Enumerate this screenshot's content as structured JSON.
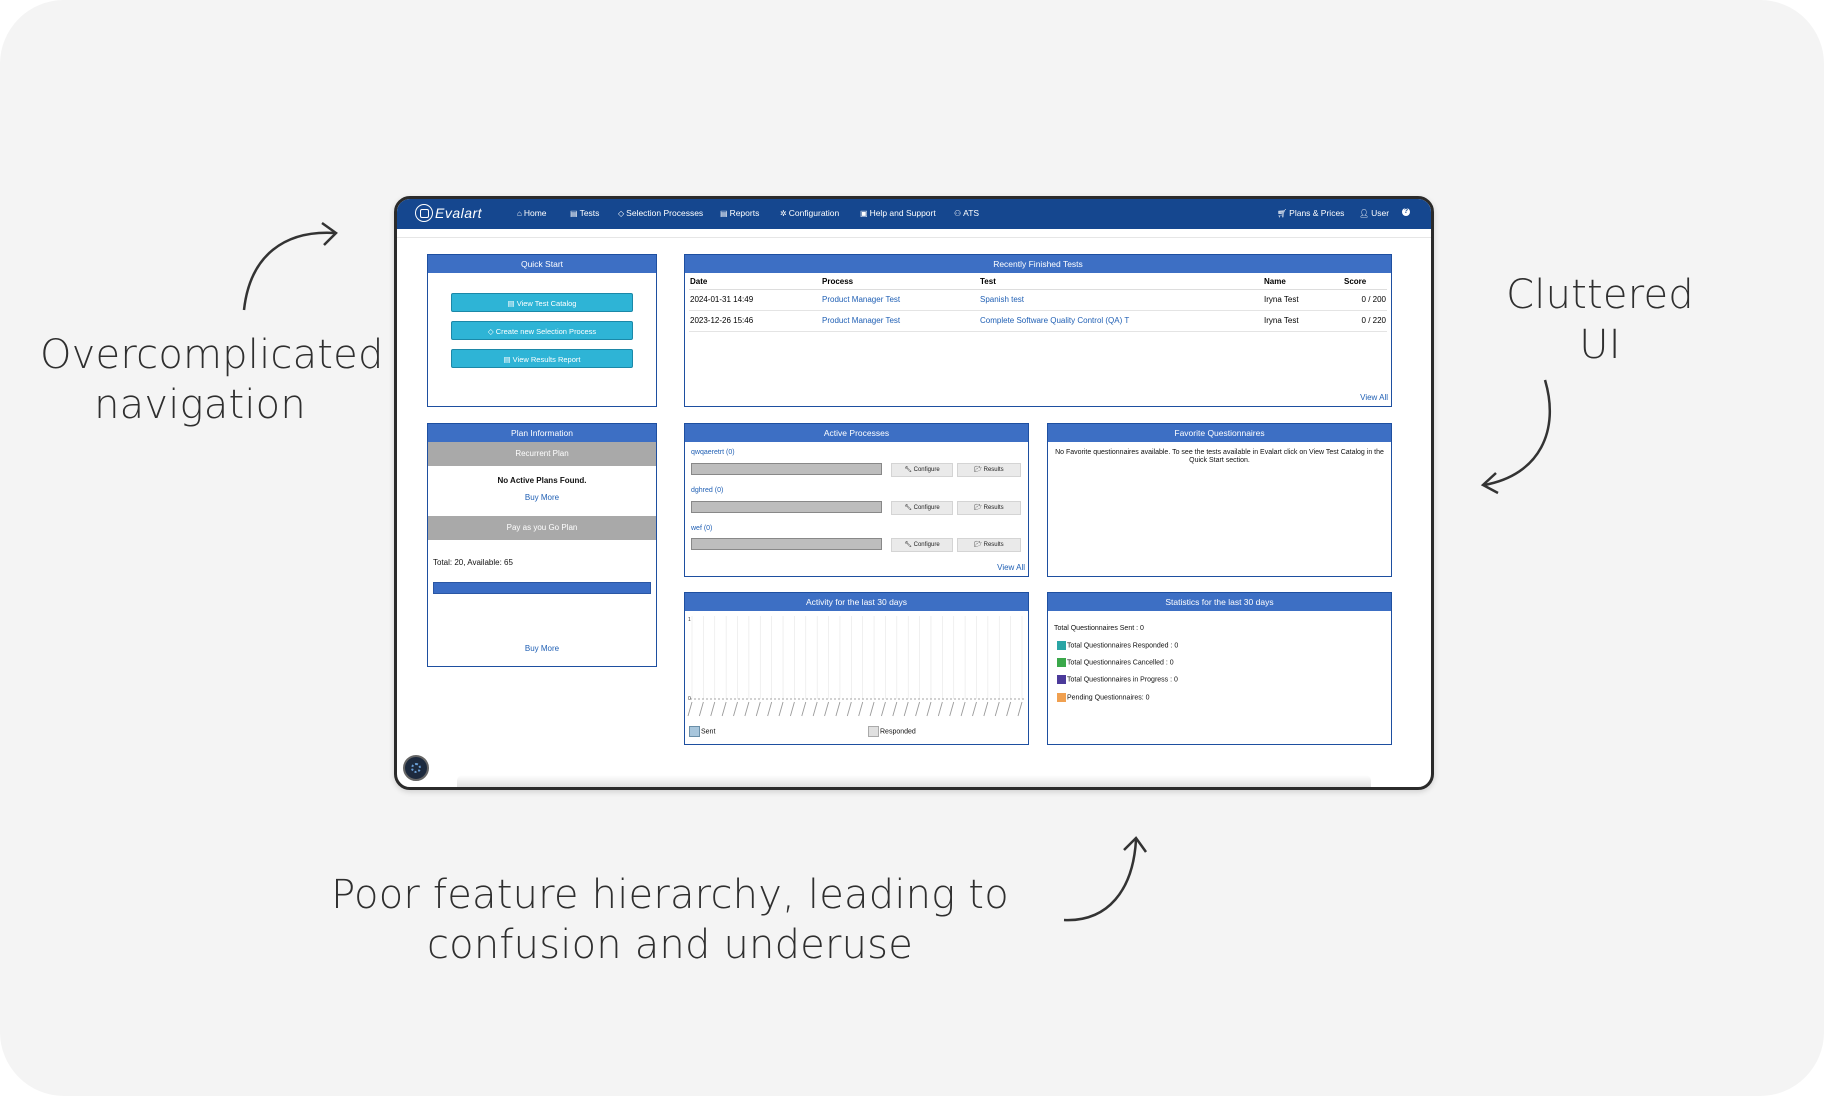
{
  "callouts": {
    "navigation": "Overcomplicated navigation",
    "cluttered": "Cluttered UI",
    "hierarchy": "Poor feature hierarchy, leading to confusion and underuse"
  },
  "nav": {
    "brand": "Evalart",
    "items": [
      {
        "label": "Home",
        "icon": "home-icon"
      },
      {
        "label": "Tests",
        "icon": "list-icon"
      },
      {
        "label": "Selection Processes",
        "icon": "diamond-icon"
      },
      {
        "label": "Reports",
        "icon": "report-icon"
      },
      {
        "label": "Configuration",
        "icon": "gear-icon"
      },
      {
        "label": "Help and Support",
        "icon": "support-icon"
      },
      {
        "label": "ATS",
        "icon": "ats-icon"
      }
    ],
    "right": [
      {
        "label": "Plans & Prices",
        "icon": "cart-icon"
      },
      {
        "label": "User",
        "icon": "user-icon"
      },
      {
        "label": "",
        "icon": "help-icon"
      }
    ]
  },
  "quick_start": {
    "title": "Quick Start",
    "buttons": [
      "View Test Catalog",
      "Create new Selection Process",
      "View Results Report"
    ]
  },
  "recent_tests": {
    "title": "Recently Finished Tests",
    "columns": [
      "Date",
      "Process",
      "Test",
      "Name",
      "Score"
    ],
    "rows": [
      [
        "2024-01-31 14:49",
        "Product Manager Test",
        "Spanish test",
        "Iryna Test",
        "0 / 200"
      ],
      [
        "2023-12-26 15:46",
        "Product Manager Test",
        "Complete Software Quality Control (QA) T",
        "Iryna Test",
        "0 / 220"
      ]
    ],
    "view_all": "View All"
  },
  "plan_info": {
    "title": "Plan Information",
    "recurrent": "Recurrent Plan",
    "no_plans": "No Active Plans Found.",
    "buy_more": "Buy More",
    "payg": "Pay as you Go Plan",
    "totals": "Total: 20, Available: 65",
    "buy_more_2": "Buy More"
  },
  "active_processes": {
    "title": "Active Processes",
    "items": [
      {
        "name": "qwqaeretrt (0)",
        "configure": "Configure",
        "results": "Results"
      },
      {
        "name": "dghred (0)",
        "configure": "Configure",
        "results": "Results"
      },
      {
        "name": "wef (0)",
        "configure": "Configure",
        "results": "Results"
      }
    ],
    "view_all": "View All"
  },
  "favorites": {
    "title": "Favorite Questionnaires",
    "message": "No Favorite questionnaires available. To see the tests available in Evalart click on View Test Catalog in the Quick Start section."
  },
  "activity": {
    "title": "Activity for the last 30 days",
    "legend": [
      "Sent",
      "Responded"
    ],
    "y_top": "1",
    "y_zero": "0"
  },
  "statistics": {
    "title": "Statistics for the last 30 days",
    "items": [
      {
        "label": "Total Questionnaires Sent : 0",
        "color": ""
      },
      {
        "label": "Total Questionnaires Responded : 0",
        "color": "#2aa5a5"
      },
      {
        "label": "Total Questionnaires Cancelled : 0",
        "color": "#3aa84a"
      },
      {
        "label": "Total Questionnaires in Progress : 0",
        "color": "#4b3a9a"
      },
      {
        "label": "Pending Questionnaires: 0",
        "color": "#f0a050"
      }
    ]
  },
  "colors": {
    "nav": "#15478f",
    "panel_head": "#3d6fc4",
    "button": "#2eb4d6",
    "link": "#1f5fb4"
  }
}
